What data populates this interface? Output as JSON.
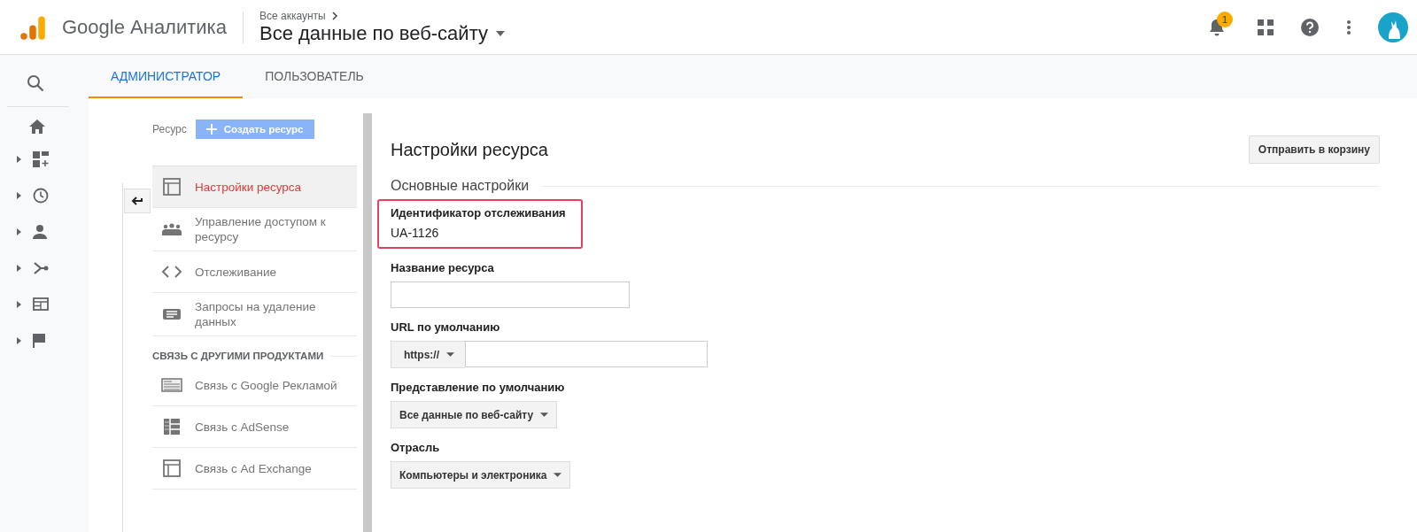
{
  "header": {
    "product": "Google Аналитика",
    "breadcrumb": "Все аккаунты",
    "view_title": "Все данные по веб-сайту",
    "notification_count": "1"
  },
  "tabs": [
    {
      "label": "АДМИНИСТРАТОР",
      "selected": true
    },
    {
      "label": "ПОЛЬЗОВАТЕЛЬ",
      "selected": false
    }
  ],
  "resource_panel": {
    "label": "Ресурс",
    "create_button": "Создать ресурс",
    "items": [
      {
        "label": "Настройки ресурса",
        "selected": true
      },
      {
        "label": "Управление доступом к ресурсу",
        "selected": false
      },
      {
        "label": "Отслеживание",
        "selected": false
      },
      {
        "label": "Запросы на удаление данных",
        "selected": false
      }
    ],
    "section_title": "СВЯЗЬ С ДРУГИМИ ПРОДУКТАМИ",
    "linked_items": [
      {
        "label": "Связь с Google Рекламой",
        "selected": false
      },
      {
        "label": "Связь с AdSense",
        "selected": false
      },
      {
        "label": "Связь с Ad Exchange",
        "selected": false
      }
    ]
  },
  "settings": {
    "title": "Настройки ресурса",
    "trash_button": "Отправить в корзину",
    "section": "Основные настройки",
    "tracking_id_label": "Идентификатор отслеживания",
    "tracking_id": "UA-1126",
    "name_label": "Название ресурса",
    "url_label": "URL по умолчанию",
    "url_protocol": "https://",
    "view_label": "Представление по умолчанию",
    "view_value": "Все данные по веб-сайту",
    "industry_label": "Отрасль",
    "industry_value": "Компьютеры и электроника"
  }
}
